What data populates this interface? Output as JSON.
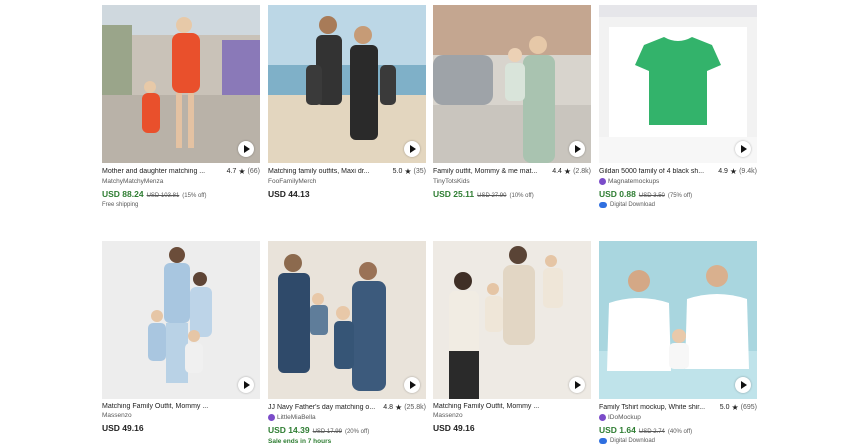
{
  "products": [
    {
      "title": "Mother and daughter matching ...",
      "rating": "4.7",
      "reviews": "(66)",
      "shop": "MatchyMatchyMenza",
      "price": "USD 88.24",
      "old_price": "USD 103.81",
      "discount": "(15% off)",
      "extra": "Free shipping"
    },
    {
      "title": "Matching family outfits, Maxi dr...",
      "rating": "5.0",
      "reviews": "(35)",
      "shop": "FooFamilyMerch",
      "price": "USD 44.13"
    },
    {
      "title": "Family outfit, Mommy & me mat...",
      "rating": "4.4",
      "reviews": "(2.8k)",
      "shop": "TinyTotsKids",
      "price": "USD 25.11",
      "old_price": "USD 27.90",
      "discount": "(10% off)"
    },
    {
      "title": "Gildan 5000 family of 4 black sh...",
      "rating": "4.9",
      "reviews": "(9.4k)",
      "shop": "Magnatemockups",
      "price": "USD 0.88",
      "old_price": "USD 3.50",
      "discount": "(75% off)",
      "extra": "Digital Download"
    },
    {
      "title": "Matching Family Outfit, Mommy ...",
      "shop": "Massenzo",
      "price": "USD 49.16"
    },
    {
      "title": "JJ Navy Father's day matching o...",
      "rating": "4.8",
      "reviews": "(25.8k)",
      "shop": "LittleMiaBella",
      "price": "USD 14.39",
      "old_price": "USD 17.99",
      "discount": "(20% off)",
      "extra": "Sale ends in 7 hours"
    },
    {
      "title": "Matching Family Outfit, Mommy ...",
      "shop": "Massenzo",
      "price": "USD 49.16"
    },
    {
      "title": "Family Tshirt mockup, White shir...",
      "rating": "5.0",
      "reviews": "(695)",
      "shop": "IDoMockup",
      "price": "USD 1.64",
      "old_price": "USD 2.74",
      "discount": "(40% off)",
      "extra": "Digital Download"
    }
  ],
  "symbols": {
    "star": "★"
  },
  "colors": {
    "sale_price": "#2e7d32",
    "star_seller_badge": "#7b4cc9",
    "download_icon": "#2f6fe0"
  },
  "icons": {
    "video": "play-icon",
    "download": "cloud-download-icon"
  }
}
